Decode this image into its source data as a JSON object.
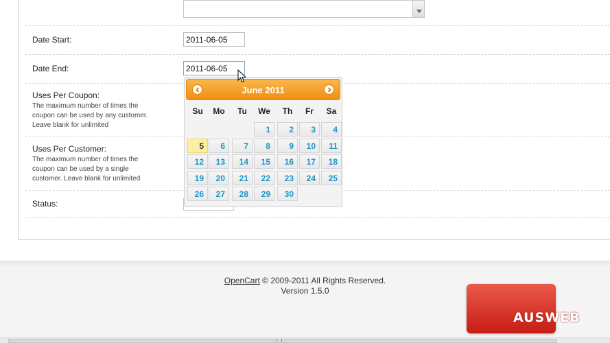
{
  "form": {
    "date_start": {
      "label": "Date Start:",
      "value": "2011-06-05"
    },
    "date_end": {
      "label": "Date End:",
      "value": "2011-06-05"
    },
    "uses_per_coupon": {
      "label": "Uses Per Coupon:",
      "help": [
        "The maximum number of times the",
        "coupon can be used by any customer.",
        "Leave blank for unlimited"
      ]
    },
    "uses_per_customer": {
      "label": "Uses Per Customer:",
      "help": [
        "The maximum number of times the",
        "coupon can be used by a single",
        "customer. Leave blank for unlimited"
      ]
    },
    "status": {
      "label": "Status:"
    }
  },
  "datepicker": {
    "month_title": "June 2011",
    "prev_icon": "chevron-left-icon",
    "next_icon": "chevron-right-icon",
    "weekdays": [
      "Su",
      "Mo",
      "Tu",
      "We",
      "Th",
      "Fr",
      "Sa"
    ],
    "first_weekday_index": 3,
    "days": [
      "1",
      "2",
      "3",
      "4",
      "5",
      "6",
      "7",
      "8",
      "9",
      "10",
      "11",
      "12",
      "13",
      "14",
      "15",
      "16",
      "17",
      "18",
      "19",
      "20",
      "21",
      "22",
      "23",
      "24",
      "25",
      "26",
      "27",
      "28",
      "29",
      "30"
    ],
    "highlighted_day": "5",
    "header_color": "#f29a1f",
    "day_text_color": "#1c94c4",
    "today_bg": "#fcefa1"
  },
  "footer": {
    "link_text": "OpenCart",
    "copyright": " © 2009-2011 All Rights Reserved.",
    "version": "Version 1.5.0"
  },
  "watermark": {
    "text": "AUSWEB",
    "color": "#d9281c"
  }
}
